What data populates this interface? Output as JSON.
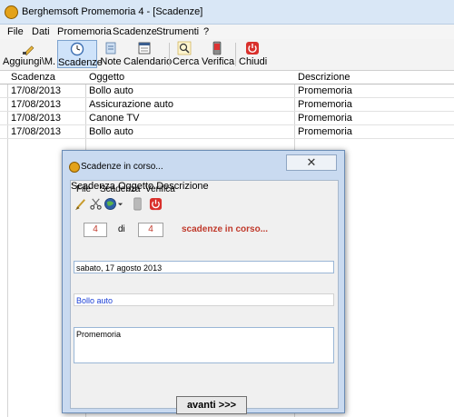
{
  "window": {
    "title": "Berghemsoft Promemoria 4 - [Scadenze]"
  },
  "menu": [
    "File",
    "Dati",
    "Promemoria",
    "Scadenze",
    "Strumenti",
    "?"
  ],
  "toolbar": [
    {
      "label": "Aggiungi\\M.",
      "icon": "pencil-icon",
      "selected": false
    },
    {
      "label": "Scadenze",
      "icon": "clock-icon",
      "selected": true
    },
    {
      "label": "Note",
      "icon": "note-icon",
      "selected": false
    },
    {
      "label": "Calendario",
      "icon": "calendar-icon",
      "selected": false
    },
    {
      "label": "Cerca",
      "icon": "magnifier-icon",
      "selected": false
    },
    {
      "label": "Verifica",
      "icon": "phone-icon",
      "selected": false
    },
    {
      "label": "Chiudi",
      "icon": "power-icon",
      "selected": false
    }
  ],
  "grid": {
    "columns": [
      "Scadenza",
      "Oggetto",
      "Descrizione"
    ],
    "rows": [
      {
        "scadenza": "17/08/2013",
        "oggetto": "Bollo auto",
        "descrizione": "Promemoria"
      },
      {
        "scadenza": "17/08/2013",
        "oggetto": "Assicurazione auto",
        "descrizione": "Promemoria"
      },
      {
        "scadenza": "17/08/2013",
        "oggetto": "Canone TV",
        "descrizione": "Promemoria"
      },
      {
        "scadenza": "17/08/2013",
        "oggetto": "Bollo auto",
        "descrizione": "Promemoria"
      }
    ]
  },
  "dialog": {
    "title": "Scadenze in corso...",
    "close_glyph": "✕",
    "menu": [
      "File",
      "Scadenza",
      "Verifica"
    ],
    "current": "4",
    "of_label": "di",
    "total": "4",
    "status_text": "scadenze in corso...",
    "scadenza_label": "Scadenza",
    "scadenza_value": "sabato, 17 agosto 2013",
    "oggetto_label": "Oggetto",
    "oggetto_value": "Bollo auto",
    "descrizione_label": "Descrizione",
    "descrizione_value": "Promemoria",
    "next_button": "avanti >>>"
  },
  "colors": {
    "accent": "#c0392b",
    "link": "#1a3fd6",
    "selection": "#cfe3fa",
    "dialog_frame": "#c9daf0"
  }
}
